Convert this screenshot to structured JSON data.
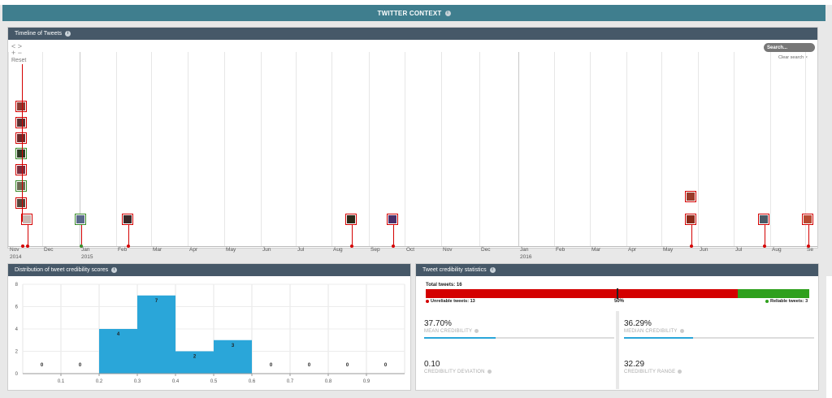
{
  "header": {
    "title": "TWITTER CONTEXT",
    "info_icon": "info-icon"
  },
  "timeline": {
    "title": "Timeline of Tweets",
    "nav_arrows": "< >",
    "zoom": "+ −",
    "reset_label": "Reset",
    "search_placeholder": "Search...",
    "clear_search": "Clear search ×",
    "months": [
      "Nov",
      "Dec",
      "Jan",
      "Feb",
      "Mar",
      "Apr",
      "May",
      "Jun",
      "Jul",
      "Aug",
      "Sep",
      "Oct",
      "Nov",
      "Dec",
      "Jan",
      "Feb",
      "Mar",
      "Apr",
      "May",
      "Jun",
      "Jul",
      "Aug",
      "Se"
    ],
    "years": [
      "2014",
      "2015",
      "2016"
    ],
    "tweets": [
      {
        "status": "unreliable",
        "color": "#8a3b32"
      },
      {
        "status": "unreliable",
        "color": "#5a3030"
      },
      {
        "status": "unreliable",
        "color": "#6c2a2a"
      },
      {
        "status": "reliable",
        "color": "#2d3a24"
      },
      {
        "status": "unreliable",
        "color": "#7a2e3e"
      },
      {
        "status": "reliable",
        "color": "#6b6a52"
      },
      {
        "status": "unreliable",
        "color": "#55463b"
      },
      {
        "status": "unreliable",
        "color": "#c8b8b2"
      },
      {
        "status": "reliable",
        "color": "#5a6a8a"
      },
      {
        "status": "unreliable",
        "color": "#3a2a2a"
      },
      {
        "status": "unreliable",
        "color": "#2b2b1a"
      },
      {
        "status": "unreliable",
        "color": "#4a2f6a"
      },
      {
        "status": "unreliable",
        "color": "#9a3a2a"
      },
      {
        "status": "unreliable",
        "color": "#8a2a1a"
      },
      {
        "status": "unreliable",
        "color": "#4a5a66"
      },
      {
        "status": "unreliable",
        "color": "#b84a32"
      }
    ]
  },
  "histogram": {
    "title": "Distribution of tweet credibility scores",
    "color": "#2aa6d9"
  },
  "chart_data": {
    "type": "bar",
    "title": "Distribution of tweet credibility scores",
    "bins": [
      {
        "from": 0.0,
        "to": 0.1,
        "count": 0
      },
      {
        "from": 0.1,
        "to": 0.2,
        "count": 0
      },
      {
        "from": 0.2,
        "to": 0.3,
        "count": 4
      },
      {
        "from": 0.3,
        "to": 0.4,
        "count": 7
      },
      {
        "from": 0.4,
        "to": 0.5,
        "count": 2
      },
      {
        "from": 0.5,
        "to": 0.6,
        "count": 3
      },
      {
        "from": 0.6,
        "to": 0.7,
        "count": 0
      },
      {
        "from": 0.7,
        "to": 0.8,
        "count": 0
      },
      {
        "from": 0.8,
        "to": 0.9,
        "count": 0
      },
      {
        "from": 0.9,
        "to": 1.0,
        "count": 0
      }
    ],
    "x_ticks": [
      "0.1",
      "0.2",
      "0.3",
      "0.4",
      "0.5",
      "0.6",
      "0.7",
      "0.8",
      "0.9"
    ],
    "y_ticks": [
      "0",
      "2",
      "4",
      "6",
      "8"
    ],
    "ylim": [
      0,
      8
    ],
    "xlim": [
      0,
      1.0
    ]
  },
  "stats": {
    "title": "Tweet credibility statistics",
    "total_label": "Total tweets: 16",
    "unreliable_label": "Unreliable tweets: 13",
    "reliable_label": "Reliable tweets: 3",
    "midpoint_label": "50%",
    "unreliable_fraction": 0.8125,
    "reliable_fraction": 0.1875,
    "colors": {
      "unreliable": "#d40000",
      "reliable": "#2fa01d"
    },
    "cards": [
      {
        "value": "37.70%",
        "label": "MEAN CREDIBILITY",
        "fill": 0.377
      },
      {
        "value": "36.29%",
        "label": "MEDIAN CREDIBILITY",
        "fill": 0.3629
      },
      {
        "value": "0.10",
        "label": "CREDIBILITY DEVIATION",
        "fill": null
      },
      {
        "value": "32.29",
        "label": "CREDIBILITY RANGE",
        "fill": null
      }
    ]
  }
}
